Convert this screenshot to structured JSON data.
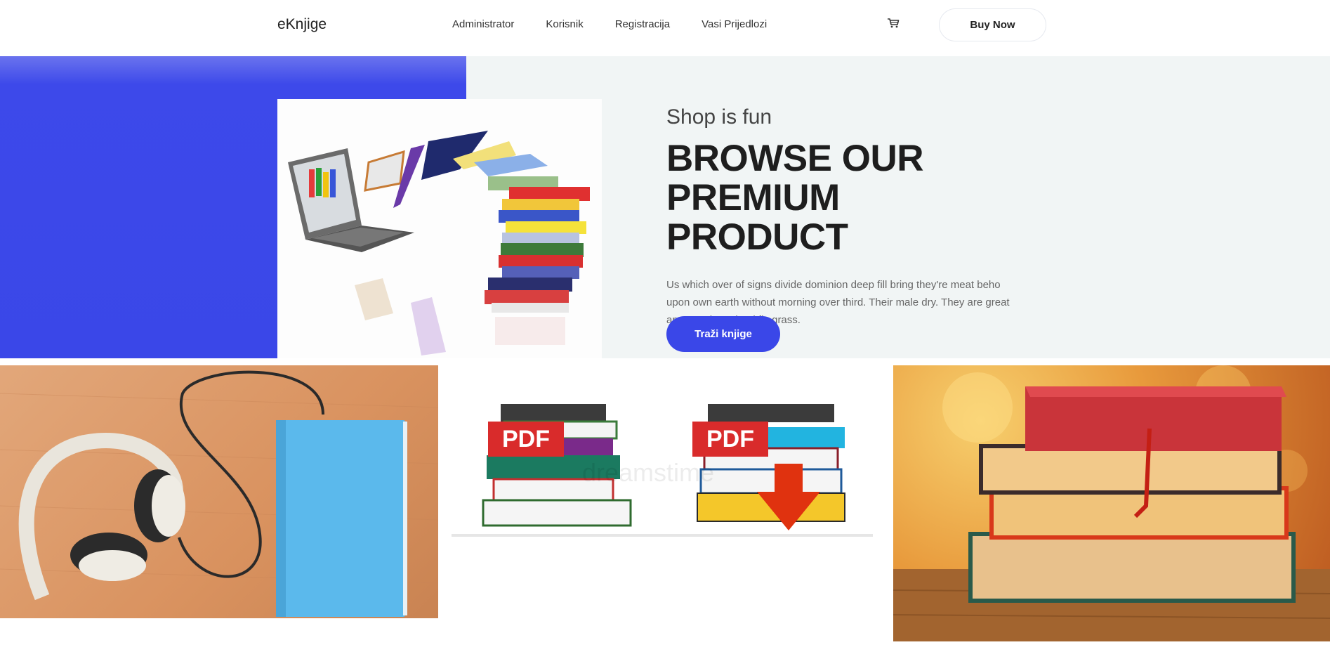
{
  "nav": {
    "brand": "eKnjige",
    "items": [
      {
        "label": "Administrator"
      },
      {
        "label": "Korisnik"
      },
      {
        "label": "Registracija"
      },
      {
        "label": "Vasi Prijedlozi"
      }
    ],
    "cart_icon": "cart-icon",
    "buy_label": "Buy Now"
  },
  "hero": {
    "kicker": "Shop is fun",
    "headline_line1": "BROWSE OUR",
    "headline_line2": "PREMIUM PRODUCT",
    "lead": "Us which over of signs divide dominion deep fill bring they're meat beho upon own earth without morning over third. Their male dry. They are great appear whose land fly grass.",
    "cta_label": "Traži knjige",
    "accent_color": "#3a47e8"
  },
  "gallery": {
    "pdf_badge": "PDF",
    "watermark": "dreamstime"
  }
}
